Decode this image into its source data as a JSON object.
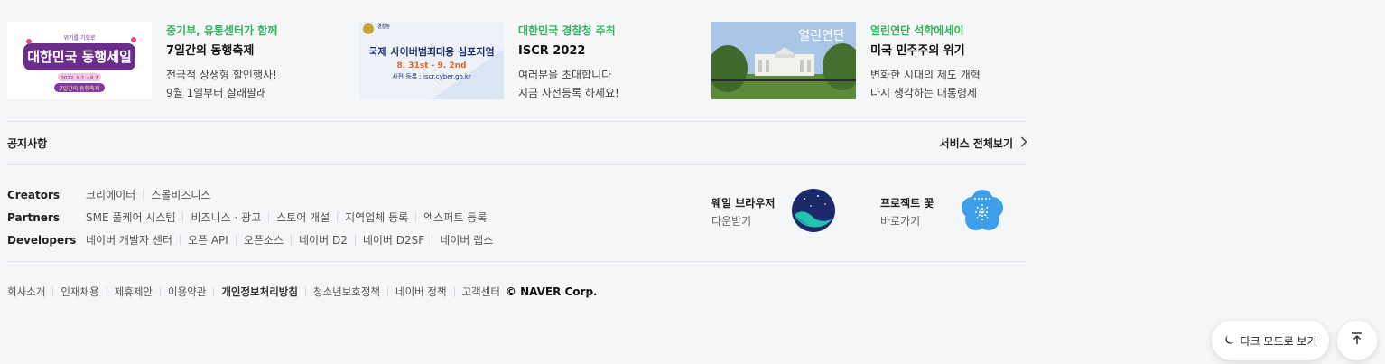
{
  "promos": [
    {
      "image_text": [
        "위기를 기회로",
        "대한민국 동행세일",
        "2022. 9.1.~9.7",
        "7일간의 동행축제"
      ],
      "eyebrow": "중기부, 유통센터가 함께",
      "title": "7일간의 동행축제",
      "desc": [
        "전국적 상생형 할인행사!",
        "9월 1일부터 살래팔래"
      ]
    },
    {
      "image_text": [
        "경찰청",
        "국제 사이버범죄대응 심포지엄",
        "8. 31st - 9. 2nd",
        "사전 등록 : iscr.cyber.go.kr"
      ],
      "eyebrow": "대한민국 경찰청 주최",
      "title": "ISCR 2022",
      "desc": [
        "여러분을 초대합니다",
        "지금 사전등록 하세요!"
      ]
    },
    {
      "image_text": [
        "열린연단"
      ],
      "eyebrow": "열린연단 석학에세이",
      "title": "미국 민주주의 위기",
      "desc": [
        "변화한 시대의 제도 개혁",
        "다시 생각하는 대통령제"
      ]
    }
  ],
  "notice": "공지사항",
  "all_services": "서비스 전체보기",
  "link_rows": [
    {
      "head": "Creators",
      "items": [
        "크리에이터",
        "스몰비즈니스"
      ]
    },
    {
      "head": "Partners",
      "items": [
        "SME 풀케어 시스템",
        "비즈니스 · 광고",
        "스토어 개설",
        "지역업체 등록",
        "엑스퍼트 등록"
      ]
    },
    {
      "head": "Developers",
      "items": [
        "네이버 개발자 센터",
        "오픈 API",
        "오픈소스",
        "네이버 D2",
        "네이버 D2SF",
        "네이버 랩스"
      ]
    }
  ],
  "apps": [
    {
      "name": "웨일 브라우저",
      "sub": "다운받기"
    },
    {
      "name": "프로젝트 꽃",
      "sub": "바로가기"
    }
  ],
  "footer": {
    "links": [
      "회사소개",
      "인재채용",
      "제휴제안",
      "이용약관",
      "개인정보처리방침",
      "청소년보호정책",
      "네이버 정책",
      "고객센터"
    ],
    "corp": "© NAVER Corp."
  },
  "buttons": {
    "dark_mode": "다크 모드로 보기"
  },
  "colors": {
    "eyebrow": "#34b25f",
    "background": "#f5f6f8"
  }
}
